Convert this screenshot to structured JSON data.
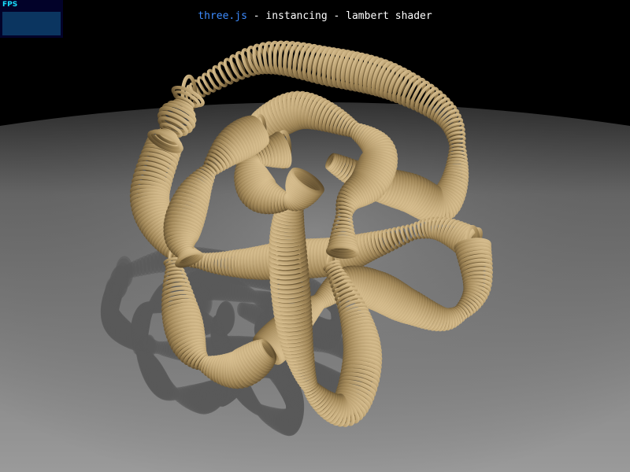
{
  "header": {
    "link_text": "three.js",
    "rest_text": " - instancing - lambert shader"
  },
  "stats": {
    "label": "FPS"
  },
  "scene": {
    "background_color": "#000000",
    "floor_color": "#8f8f8f",
    "object_color": "#a58d5e",
    "shadow_color": "#5a5a5a"
  }
}
